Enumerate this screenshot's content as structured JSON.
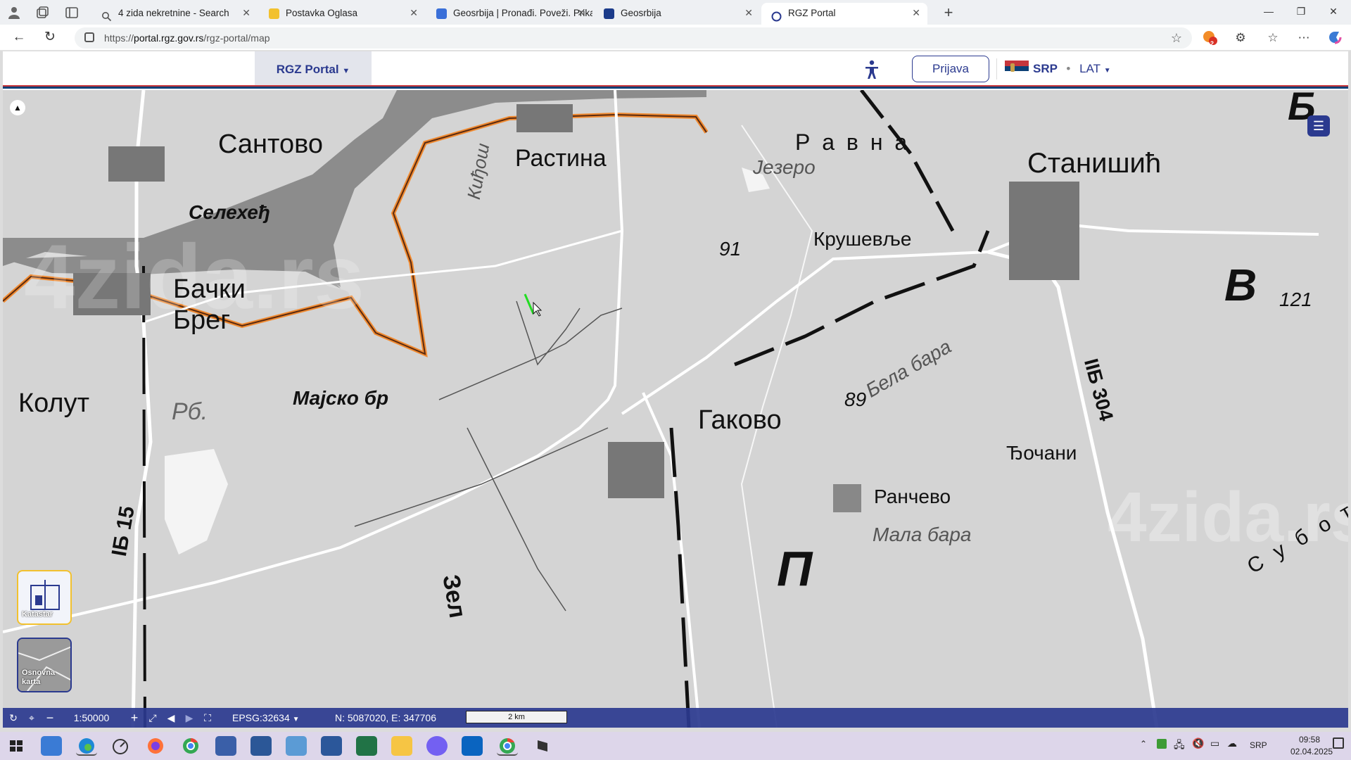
{
  "browser": {
    "tabs": [
      {
        "title": "4 zida nekretnine - Search",
        "color": "#1a73e8"
      },
      {
        "title": "Postavka Oglasa",
        "color": "#f2c12e"
      },
      {
        "title": "Geosrbija | Pronađi. Poveži. Prikaž",
        "color": "#3a6fd8"
      },
      {
        "title": "Geosrbija",
        "color": "#1b3b8a"
      },
      {
        "title": "RGZ Portal",
        "color": "#2b3a8f"
      }
    ],
    "url_prefix": "https://",
    "url_host": "portal.rgz.gov.rs",
    "url_path": "/rgz-portal/map",
    "extension_badge": "2"
  },
  "site": {
    "menu_label": "RGZ Portal",
    "login_label": "Prijava",
    "lang_main": "SRP",
    "lang_sep": "•",
    "lang_script": "LAT"
  },
  "map": {
    "labels": {
      "santovo": "Сантово",
      "rastina": "Растина",
      "kidjos": "Киђош",
      "ravna": "Р а в н а",
      "jezero": "Језеро",
      "stanisic": "Станишић",
      "selehedj": "Селехеђ",
      "krusevlje": "Крушевље",
      "elev91": "91",
      "backi": "Бачки",
      "breg": "Брег",
      "region_b": "В",
      "elev121": "121",
      "majsko": "Мајско бр",
      "kolut": "Колут",
      "rb": "Рб.",
      "gakovo": "Гаково",
      "elev89": "89",
      "bela_bara": "Бела бара",
      "road304": "IIБ 304",
      "djocani": "Ђочани",
      "rancevo": "Ранчево",
      "mala_bara": "Мала бара",
      "road15": "IБ 15",
      "zel": "Зел",
      "region_p": "П",
      "subotica": "С у б о т",
      "region_b_top": "Б"
    },
    "watermark": "4zida.rs",
    "basemaps": [
      {
        "label": "Katastar",
        "selected": true
      },
      {
        "label": "Osnovna karta",
        "selected": false
      }
    ]
  },
  "toolbar": {
    "scale": "1:50000",
    "projection": "EPSG:32634",
    "coordinates": "N: 5087020, E: 347706",
    "scalebar_label": "2 km"
  },
  "taskbar": {
    "lang": "SRP",
    "time": "09:58",
    "date": "02.04.2025"
  }
}
